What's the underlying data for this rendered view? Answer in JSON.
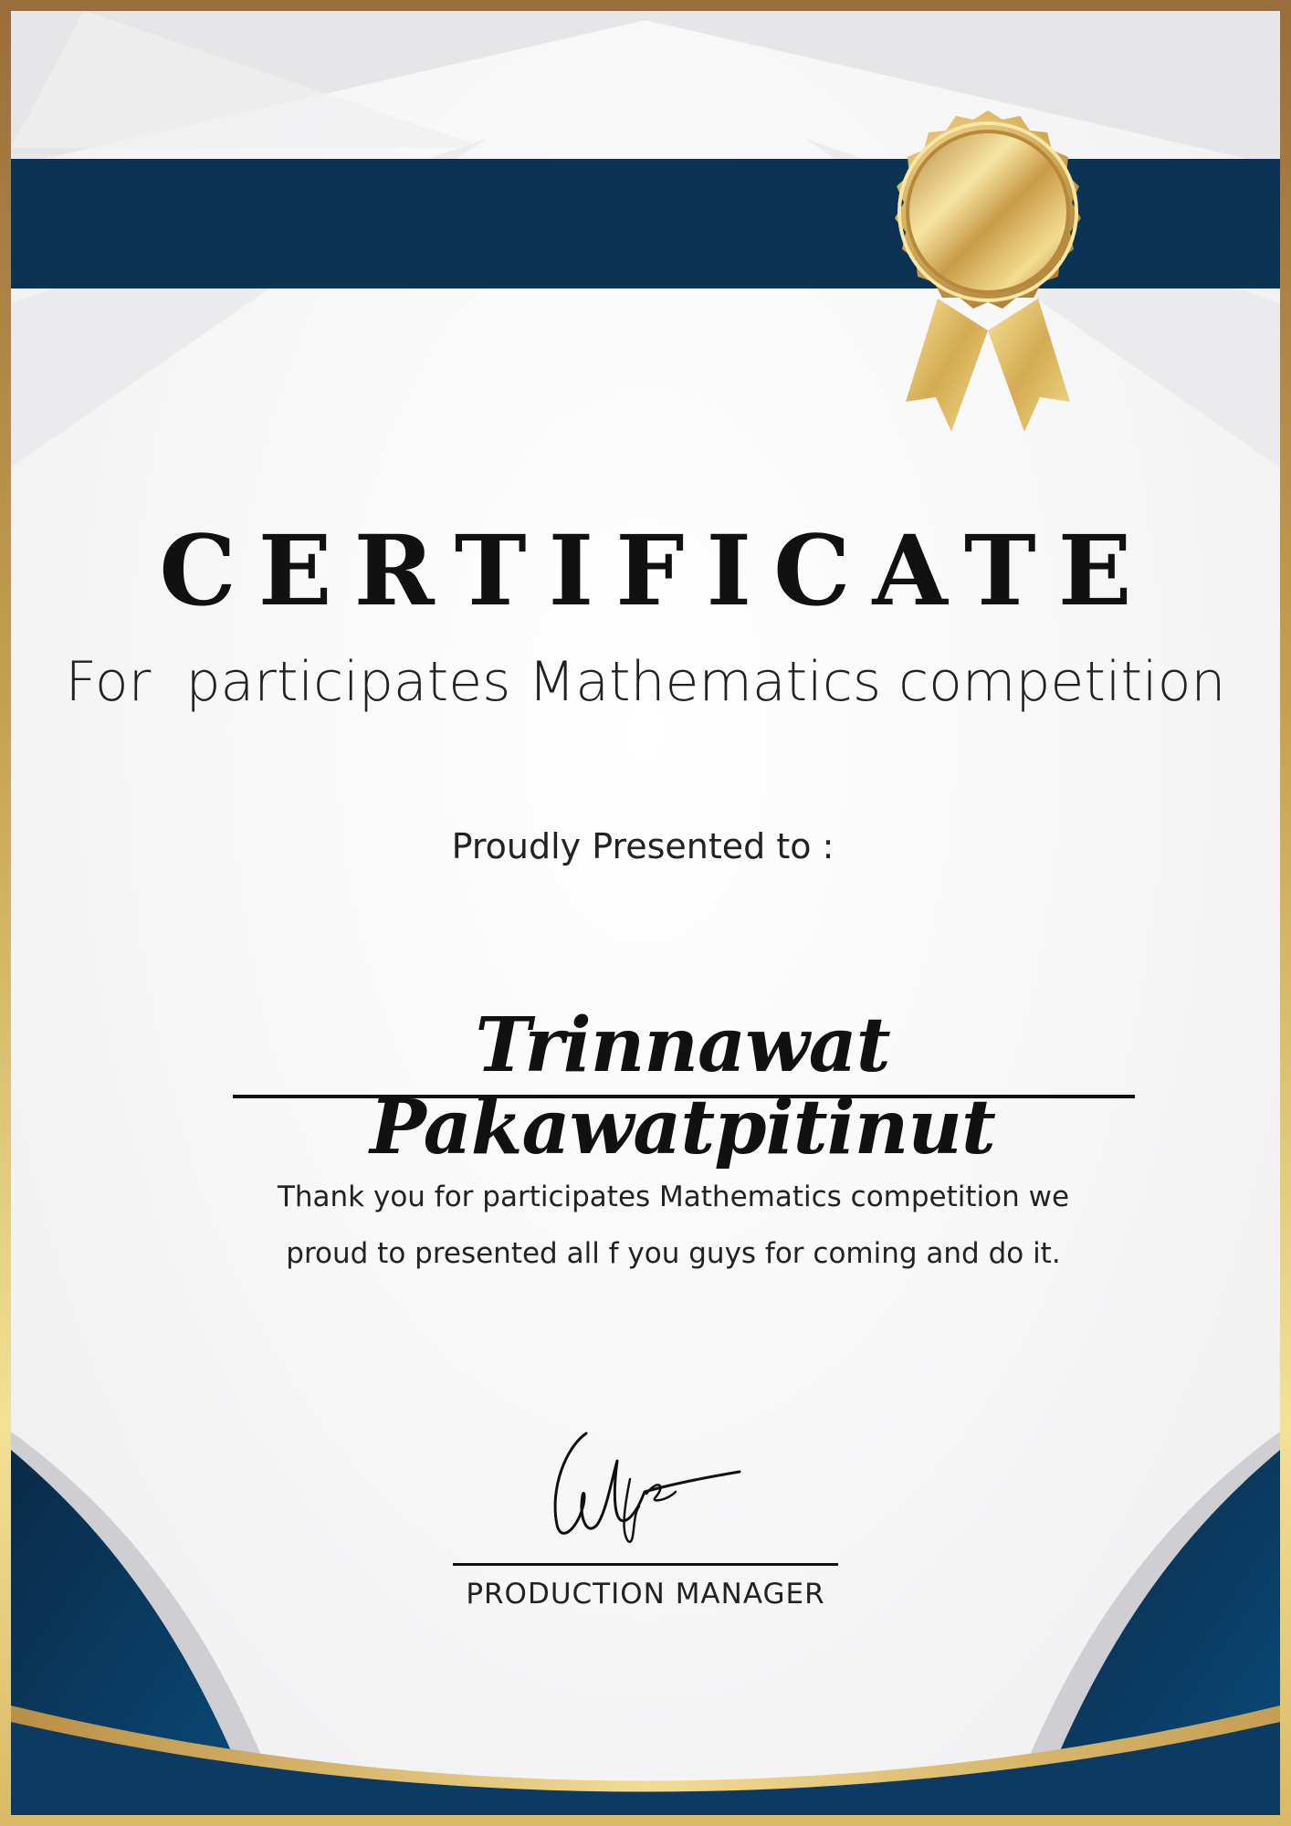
{
  "certificate": {
    "title": "CERTIFICATE",
    "subtitle": "For  participates Mathematics competition",
    "presented_to_label": "Proudly Presented to :",
    "recipient_name": "Trinnawat Pakawatpitinut",
    "message_line_1": "Thank you for participates Mathematics competition we",
    "message_line_2": "proud to presented all f you guys for coming and do it.",
    "signature_text": "Ulfa",
    "signatory_role": "PRODUCTION MANAGER"
  },
  "theme": {
    "navy": "#0b3354",
    "gold": "#d4ae5a",
    "frame_gold": "#b48a46"
  },
  "icons": {
    "seal": "gold-medal-ribbon-icon"
  }
}
